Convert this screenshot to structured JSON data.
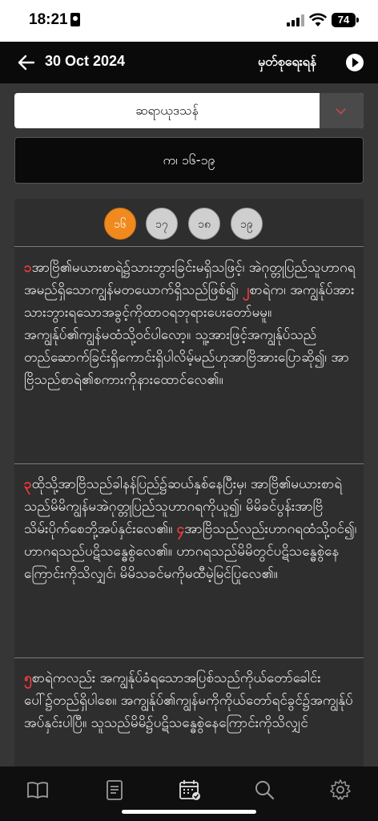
{
  "status": {
    "time": "18:21",
    "battery": "74"
  },
  "header": {
    "date": "30 Oct 2024",
    "note_label": "မှတ်စုရေးရန်"
  },
  "book_select": {
    "selected": "ဆရာယုဒသန်"
  },
  "reference": "က၊ ၁၆-၁၉",
  "chips": [
    {
      "label": "၁၆",
      "active": true
    },
    {
      "label": "၁၇",
      "active": false
    },
    {
      "label": "၁၈",
      "active": false
    },
    {
      "label": "၁၉",
      "active": false
    }
  ],
  "paragraphs": [
    {
      "segments": [
        {
          "num": "၁",
          "text": "အာဗြိ၏မယားစာရဲ၌သားဘွားခြင်းမရှိသဖြင့်၊ အဲဂုတ္တုပြည်သူဟာဂရအမည်ရှိသောကျွန်မတယောက်ရှိသည်ဖြစ်၍၊ "
        },
        {
          "num": "၂",
          "text": "စာရဲက၊ အကျွန်ုပ်အားသားဘွားရသောအခွင့်ကိုထာဝရဘုရားပေးတော်မမူ။ အကျွန်ုပ်၏ကျွန်မထံသို့ဝင်ပါလော့။ သူ့အားဖြင့်အကျွန်ုပ်သည်တည်ဆောက်ခြင်းရှိကောင်းရှိပါလိမ့်မည်ဟုအာဗြိအားပြောဆို၍၊ အာဗြိသည်စာရဲ၏စကားကိုနားထောင်လေ၏။"
        }
      ]
    },
    {
      "segments": [
        {
          "num": "၃",
          "text": "ထိုသို့အာဗြိသည်ခါနန်ပြည်၌ဆယ်နှစ်နေပြီးမှ၊ အာဗြိ၏မယားစာရဲသည်မိမိကျွန်မအဲဂုတ္တုပြည်သူဟာဂရကိုယူ၍၊ မိမိခင်ပွန်းအာဗြိသိမ်းပိုက်စေဘို့အပ်နှင်းလေ၏။ "
        },
        {
          "num": "၄",
          "text": "အာဗြိသည်လည်းဟာဂရထံသို့ဝင်၍၊ ဟာဂရသည်ပဋိသန္ဓေစွဲလေ၏။ ဟာဂရသည်မိမိတွင်ပဋိသန္ဓေစွဲနေကြောင်းကိုသိလျှင်၊ မိမိသခင်မကိုမထီမဲ့မြင်ပြုလေ၏။"
        }
      ]
    },
    {
      "segments": [
        {
          "num": "၅",
          "text": "စာရဲကလည်း အကျွန်ုပ်ခံရသောအပြစ်သည်ကိုယ်တော်ခေါင်းပေါ်၌တည်ရှိပါစေ။ အကျွန်ုပ်၏ကျွန်မကိုကိုယ်တော်ရင်ခွင်၌အကျွန်ုပ်အပ်နှင်းပါပြီ။ သူသည်မိမိ၌ပဋိသန္ဓေစွဲနေကြောင်းကိုသိလျှင်"
        }
      ]
    }
  ],
  "tabs": [
    {
      "name": "bible-icon"
    },
    {
      "name": "notes-icon"
    },
    {
      "name": "calendar-icon"
    },
    {
      "name": "search-icon"
    },
    {
      "name": "gear-icon"
    }
  ],
  "colors": {
    "accent": "#f08a1f",
    "verse_number": "#ff3b3b",
    "header_bg": "#0a0a0a",
    "content_bg": "#363636"
  }
}
